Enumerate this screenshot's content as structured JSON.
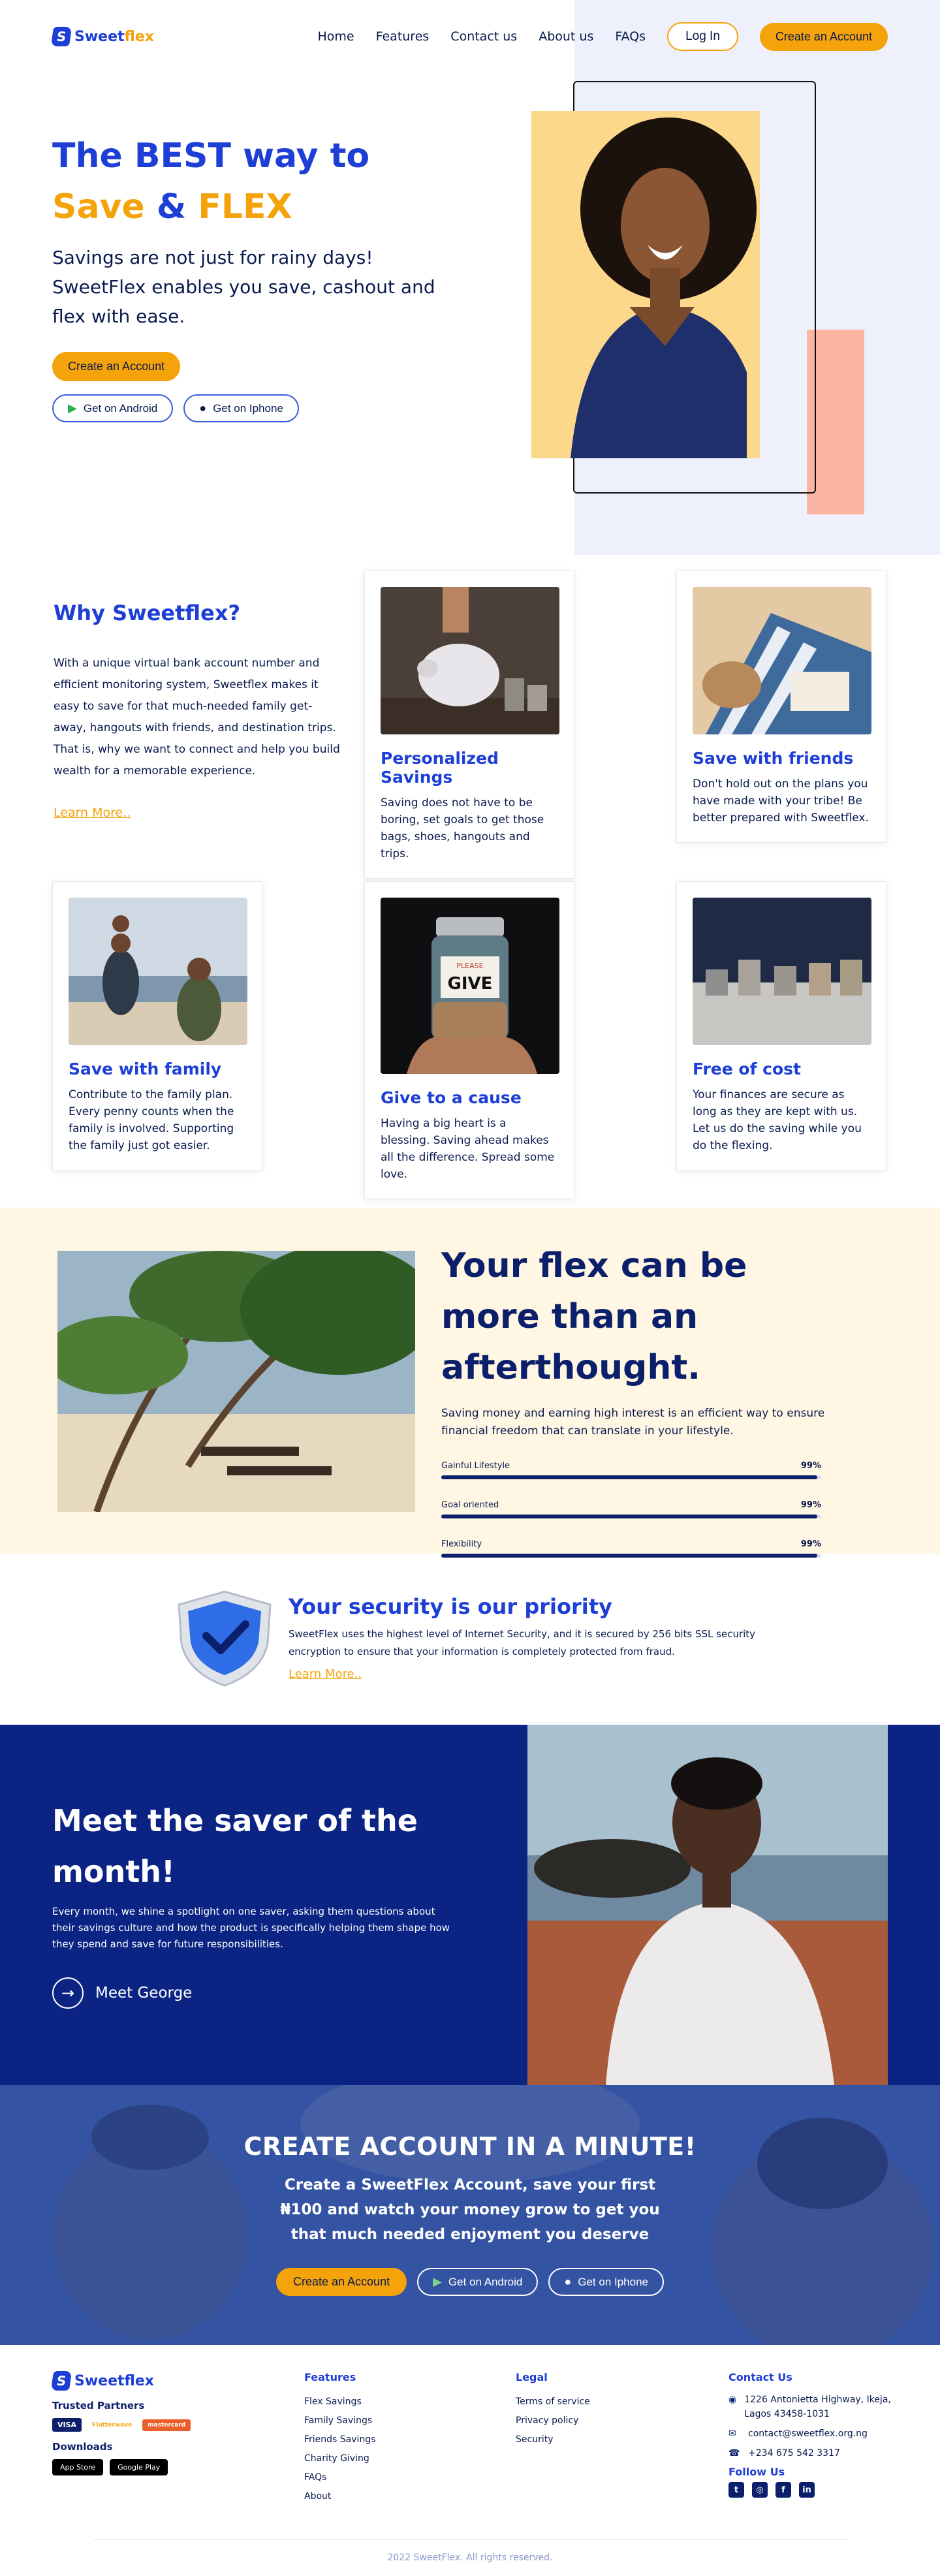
{
  "brand": {
    "name_sweet": "Sweet",
    "name_flex": "flex",
    "mark": "S"
  },
  "nav": {
    "links": [
      "Home",
      "Features",
      "Contact us",
      "About us",
      "FAQs"
    ],
    "login": "Log In",
    "create_account": "Create an Account"
  },
  "hero": {
    "title_line1": "The BEST way to",
    "title_save": "Save",
    "title_amp": "&",
    "title_flex": "FLEX",
    "subtitle": "Savings are not just for rainy days! SweetFlex enables you save, cashout and flex with ease.",
    "cta": "Create an Account",
    "android": "Get on Android",
    "iphone": "Get on Iphone"
  },
  "why": {
    "title": "Why Sweetflex?",
    "body": "With a unique virtual bank account number and efficient monitoring system, Sweetflex makes it easy to save for that much-needed family get-away, hangouts with friends, and destination trips. That is, why we want to connect and help you build wealth for a memorable experience.",
    "learn_more": "Learn More..",
    "cards": [
      {
        "title": "Personalized Savings",
        "text": "Saving does not have to be boring, set goals to get those bags, shoes, hangouts and trips."
      },
      {
        "title": "Save with friends",
        "text": "Don't hold out on the plans you have made with your tribe! Be better prepared with Sweetflex."
      },
      {
        "title": "Save with family",
        "text": "Contribute to the family plan. Every penny counts when the family is involved. Supporting the family just got easier."
      },
      {
        "title": "Give to a cause",
        "text": "Having a big heart is a blessing. Saving ahead makes all the difference. Spread some love."
      },
      {
        "title": "Free of cost",
        "text": "Your finances are secure as long as they are kept with us. Let us do the saving while you do the flexing."
      }
    ],
    "jar_label_top": "PLEASE",
    "jar_label_main": "GIVE"
  },
  "flex": {
    "title": "Your flex can be more than an afterthought.",
    "desc": "Saving money and earning high interest is an efficient way to ensure financial freedom that can translate in your lifestyle.",
    "bars": [
      {
        "label": "Gainful Lifestyle",
        "pct_text": "99%",
        "value": 0.99
      },
      {
        "label": "Goal oriented",
        "pct_text": "99%",
        "value": 0.99
      },
      {
        "label": "Flexibility",
        "pct_text": "99%",
        "value": 0.99
      }
    ]
  },
  "security": {
    "title": "Your security is our priority",
    "body": "SweetFlex uses the highest level of Internet Security, and it is secured by 256 bits SSL security encryption to ensure that your information is completely protected from fraud.",
    "learn_more": "Learn More.."
  },
  "saver": {
    "title": "Meet the saver of the month!",
    "body": "Every month, we shine a spotlight on one saver, asking them questions about their savings culture and how the product is specifically helping them shape how they spend and save for future responsibilities.",
    "cta": "Meet George"
  },
  "cta": {
    "title": "CREATE ACCOUNT IN A MINUTE!",
    "sub": "Create a SweetFlex Account, save your first ₦100 and watch your money grow to get you that much needed enjoyment you deserve",
    "create": "Create an Account",
    "android": "Get on Android",
    "iphone": "Get on Iphone"
  },
  "footer": {
    "trusted": "Trusted Partners",
    "partners": [
      "VISA",
      "Flutterwave",
      "mastercard"
    ],
    "downloads": "Downloads",
    "apps": [
      "App Store",
      "Google Play"
    ],
    "features_h": "Features",
    "features": [
      "Flex Savings",
      "Family Savings",
      "Friends Savings",
      "Charity Giving",
      "FAQs",
      "About"
    ],
    "legal_h": "Legal",
    "legal": [
      "Terms of service",
      "Privacy policy",
      "Security"
    ],
    "contact_h": "Contact Us",
    "address": "1226 Antonietta Highway, Ikeja, Lagos 43458-1031",
    "email": "contact@sweetflex.org.ng",
    "phone": "+234 675 542 3317",
    "follow": "Follow Us",
    "copyright": "2022 SweetFlex. All rights reserved."
  },
  "colors": {
    "primary": "#1d3fd6",
    "accent": "#f5a30b",
    "navy": "#0b2484",
    "cream": "#fff6e3"
  }
}
